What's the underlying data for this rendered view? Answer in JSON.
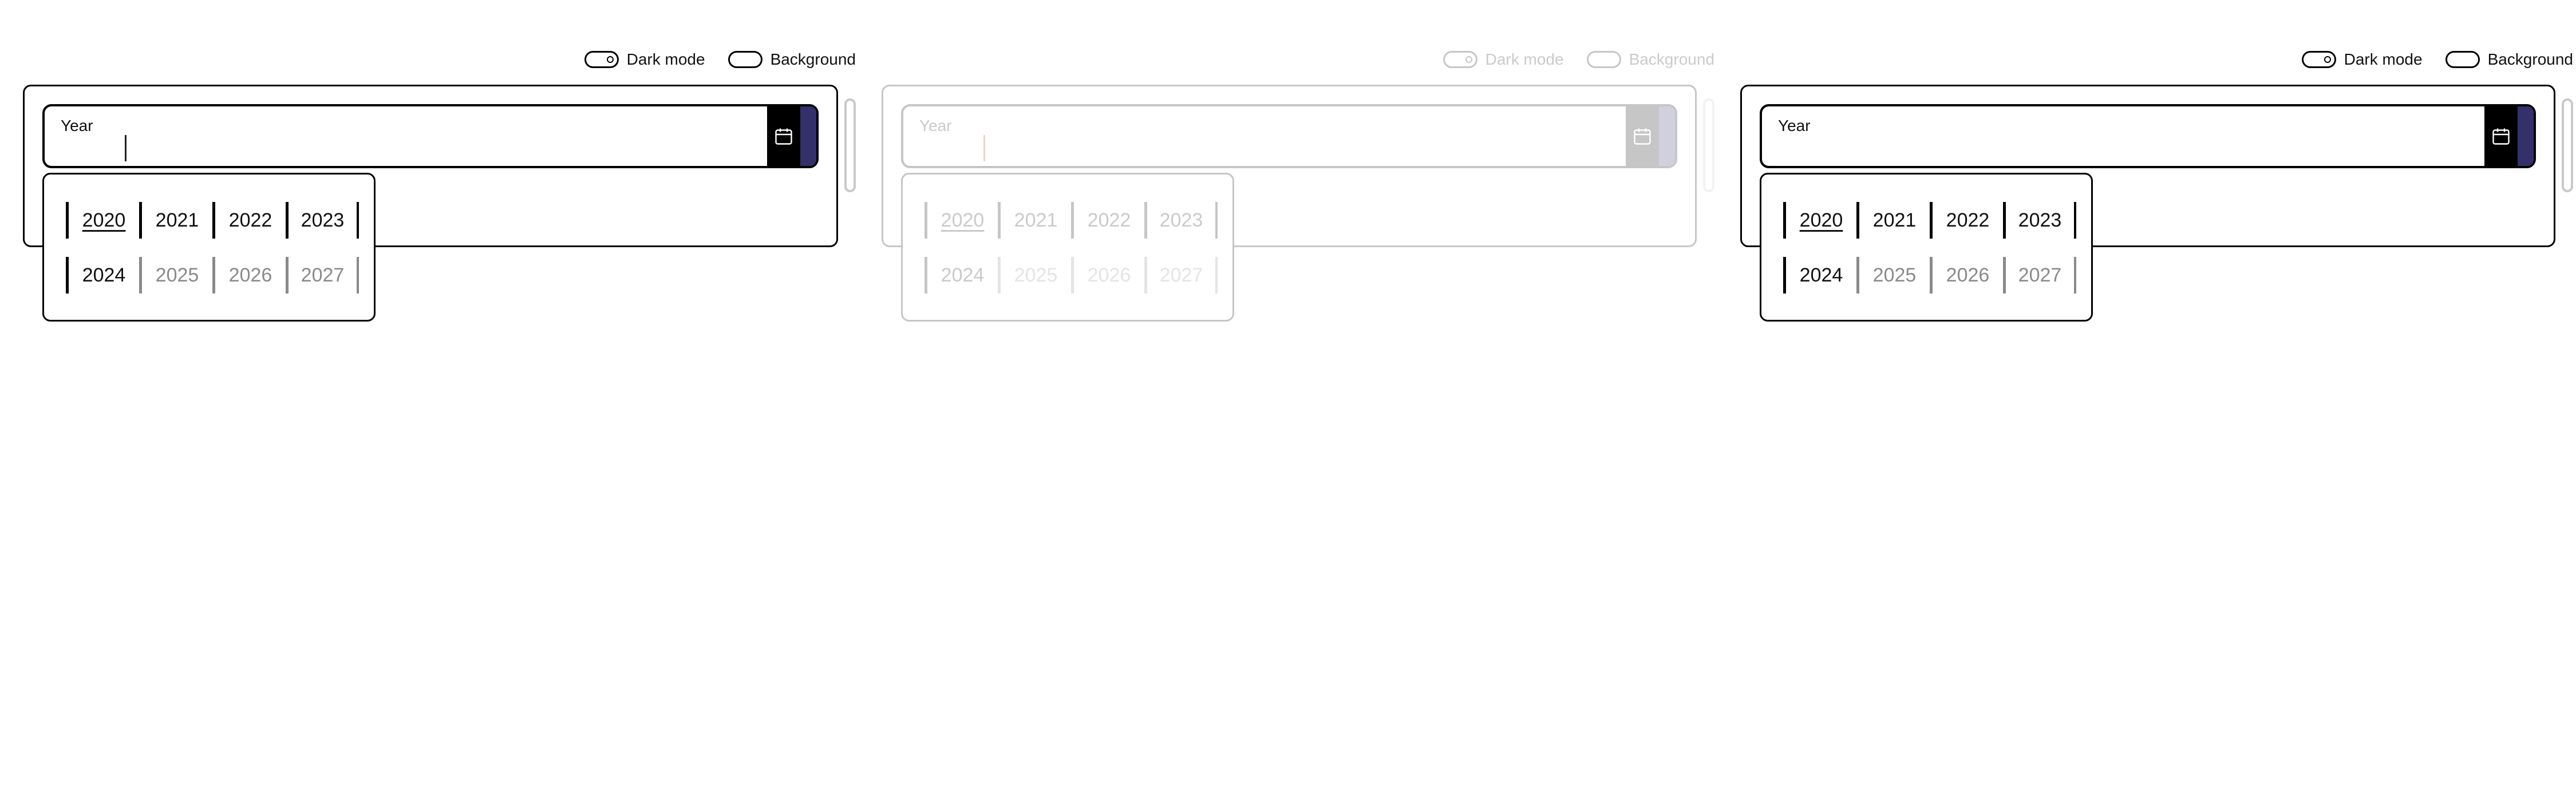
{
  "toggles": {
    "dark_mode_label": "Dark mode",
    "background_label": "Background"
  },
  "field": {
    "label": "Year",
    "value": ""
  },
  "years": [
    "2020",
    "2021",
    "2022",
    "2023",
    "2024",
    "2025",
    "2026",
    "2027"
  ],
  "current_year": "2020",
  "colors": {
    "accent": "#33306b",
    "button": "#000000",
    "caret_disabled_panel": "#d12a00"
  }
}
